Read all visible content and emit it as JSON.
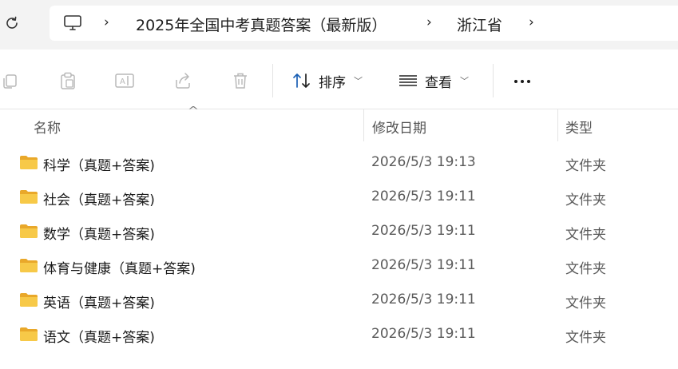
{
  "address_bar": {
    "breadcrumbs": [
      "2025年全国中考真题答案（最新版）",
      "浙江省"
    ]
  },
  "toolbar": {
    "sort_label": "排序",
    "view_label": "查看"
  },
  "columns": {
    "name": "名称",
    "date": "修改日期",
    "type": "类型"
  },
  "rows": [
    {
      "name": "科学（真题+答案)",
      "date": "2026/5/3 19:13",
      "type": "文件夹"
    },
    {
      "name": "社会（真题+答案)",
      "date": "2026/5/3 19:11",
      "type": "文件夹"
    },
    {
      "name": "数学（真题+答案)",
      "date": "2026/5/3 19:11",
      "type": "文件夹"
    },
    {
      "name": "体育与健康（真题+答案)",
      "date": "2026/5/3 19:11",
      "type": "文件夹"
    },
    {
      "name": "英语（真题+答案)",
      "date": "2026/5/3 19:11",
      "type": "文件夹"
    },
    {
      "name": "语文（真题+答案)",
      "date": "2026/5/3 19:11",
      "type": "文件夹"
    }
  ],
  "colors": {
    "folder": "#f7c948",
    "folder_dark": "#e9a82a",
    "toolbar_disabled": "#b8b8b8",
    "sort_accent": "#1a5fb4"
  },
  "icons": [
    "refresh-icon",
    "this-pc-icon",
    "copy-icon",
    "paste-icon",
    "rename-icon",
    "share-icon",
    "delete-icon",
    "sort-icon",
    "view-icon",
    "more-icon",
    "folder-icon"
  ]
}
